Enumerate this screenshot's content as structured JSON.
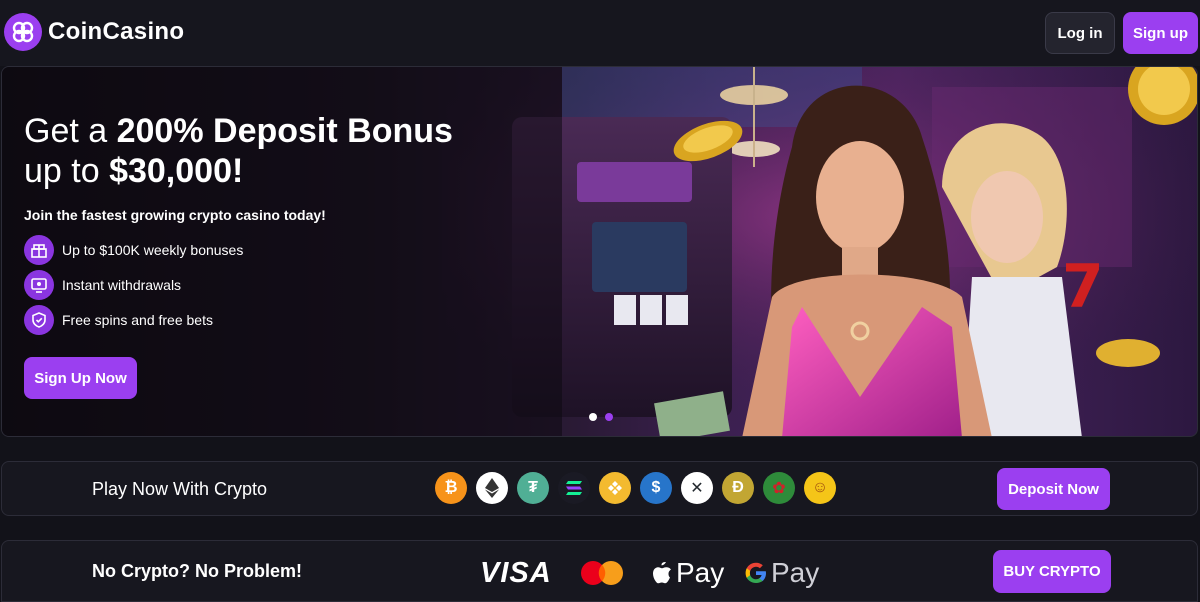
{
  "brand": {
    "name": "CoinCasino",
    "accent": "#9b3ff0"
  },
  "header": {
    "login_label": "Log in",
    "signup_label": "Sign up"
  },
  "hero": {
    "title_prefix": "Get a ",
    "title_bold": "200% Deposit Bonus",
    "title_line2_prefix": "up to ",
    "title_line2_bold": "$30,000!",
    "subtitle": "Join the fastest growing crypto casino today!",
    "features": [
      {
        "icon": "bonus-icon",
        "text": "Up to $100K weekly bonuses"
      },
      {
        "icon": "withdrawal-icon",
        "text": "Instant withdrawals"
      },
      {
        "icon": "shield-icon",
        "text": "Free spins and free bets"
      }
    ],
    "cta_label": "Sign Up Now",
    "carousel": {
      "slides": 2,
      "active": 2
    }
  },
  "crypto_bar": {
    "label": "Play Now With Crypto",
    "coins": [
      {
        "name": "bitcoin-icon",
        "color": "#f7931a",
        "glyph": "₿"
      },
      {
        "name": "ethereum-icon",
        "color": "#ffffff",
        "glyph": "◆"
      },
      {
        "name": "tether-icon",
        "color": "#50af95",
        "glyph": "₮"
      },
      {
        "name": "solana-icon",
        "color": "#9945ff",
        "glyph": "≡"
      },
      {
        "name": "bnb-icon",
        "color": "#f3ba2f",
        "glyph": "◈"
      },
      {
        "name": "usdc-icon",
        "color": "#2775ca",
        "glyph": "$"
      },
      {
        "name": "xrp-icon",
        "color": "#ffffff",
        "glyph": "✕"
      },
      {
        "name": "dogecoin-icon",
        "color": "#c2a633",
        "glyph": "Ð"
      },
      {
        "name": "rose-token-icon",
        "color": "#2e8b3a",
        "glyph": "✿"
      },
      {
        "name": "shiba-icon",
        "color": "#f5c518",
        "glyph": "☺"
      }
    ],
    "button_label": "Deposit Now"
  },
  "fiat_bar": {
    "label": "No Crypto? No Problem!",
    "methods": {
      "visa": "VISA",
      "apple_pay": "Pay",
      "google_pay": "Pay"
    },
    "button_label": "BUY CRYPTO"
  }
}
